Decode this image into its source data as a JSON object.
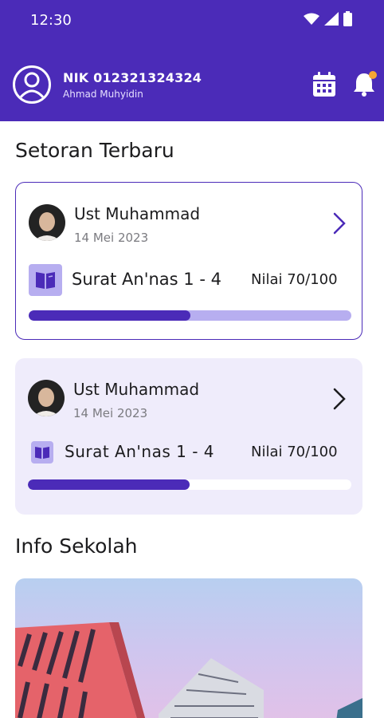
{
  "status_bar": {
    "time": "12:30",
    "icons": [
      "wifi-icon",
      "signal-icon",
      "battery-icon"
    ]
  },
  "header": {
    "nik": "NIK 012321324324",
    "name": "Ahmad Muhyidin",
    "icons": [
      "avatar-icon",
      "calendar-icon",
      "bell-icon"
    ],
    "notification_dot_color": "#f6a534"
  },
  "setoran": {
    "title": "Setoran Terbaru",
    "items": [
      {
        "teacher": "Ust Muhammad",
        "date": "14 Mei 2023",
        "surah": "Surat An'nas 1 - 4",
        "nilai": "Nilai 70/100",
        "progress": 0.5,
        "track_color": "#b7aef0"
      },
      {
        "teacher": "Ust Muhammad",
        "date": "14 Mei 2023",
        "surah": "Surat An'nas 1 - 4",
        "nilai": "Nilai 70/100",
        "progress": 0.5,
        "track_color": "#ffffff"
      }
    ]
  },
  "info": {
    "title": "Info Sekolah"
  },
  "colors": {
    "primary": "#4b2bb8",
    "accent": "#b7aef0",
    "card_bg": "#efecfb"
  }
}
